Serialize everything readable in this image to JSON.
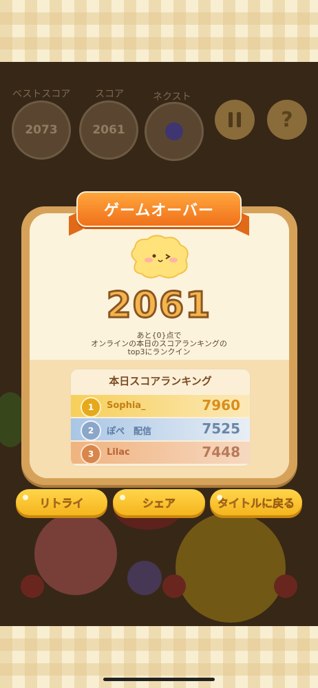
{
  "hud": {
    "best_label": "ベストスコア",
    "best_value": "2073",
    "score_label": "スコア",
    "score_value": "2061",
    "next_label": "ネクスト",
    "next_icon": "grape-icon"
  },
  "dialog": {
    "title": "ゲームオーバー",
    "final_score": "2061",
    "message_line1": "あと{0}点で",
    "message_line2": "オンラインの本日のスコアランキングの",
    "message_line3": "top3にランクイン"
  },
  "ranking": {
    "title": "本日スコアランキング",
    "rows": [
      {
        "rank": "1",
        "name": "Sophia_",
        "score": "7960",
        "color": "#f1c232"
      },
      {
        "rank": "2",
        "name": "ぽぺ　配信",
        "score": "7525",
        "color": "#a9c6e6"
      },
      {
        "rank": "3",
        "name": "Lilac",
        "score": "7448",
        "color": "#f0b37f"
      }
    ]
  },
  "buttons": {
    "retry": "リトライ",
    "share": "シェア",
    "title": "タイトルに戻る"
  },
  "icons": {
    "pause": "pause-icon",
    "help": "?"
  }
}
